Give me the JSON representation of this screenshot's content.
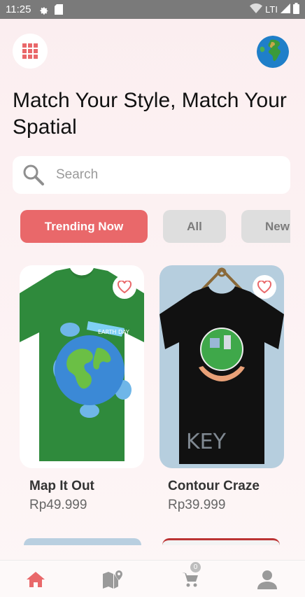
{
  "status_bar": {
    "time": "11:25",
    "network": "LTI",
    "icons": [
      "settings-icon",
      "sd-card-icon",
      "wifi-icon",
      "signal-icon",
      "battery-icon"
    ]
  },
  "header": {
    "menu_icon": "grid-menu-icon",
    "avatar_icon": "globe-avatar"
  },
  "title": "Match Your Style, Match Your Spatial",
  "search": {
    "placeholder": "Search",
    "icon": "search-icon"
  },
  "filters": {
    "trending": "Trending Now",
    "all": "All",
    "new": "New"
  },
  "products": [
    {
      "name": "Map It Out",
      "price": "Rp49.999",
      "shirt_color": "#2f8a3c",
      "favorite": false
    },
    {
      "name": "Contour Craze",
      "price": "Rp39.999",
      "shirt_color": "#111111",
      "favorite": false
    }
  ],
  "bottom_nav": {
    "cart_count": "0",
    "items": [
      "home-icon",
      "map-icon",
      "cart-icon",
      "profile-icon"
    ]
  },
  "colors": {
    "accent": "#e9686a",
    "chip_inactive": "#dedede",
    "status_bar": "#7a7a7a"
  }
}
